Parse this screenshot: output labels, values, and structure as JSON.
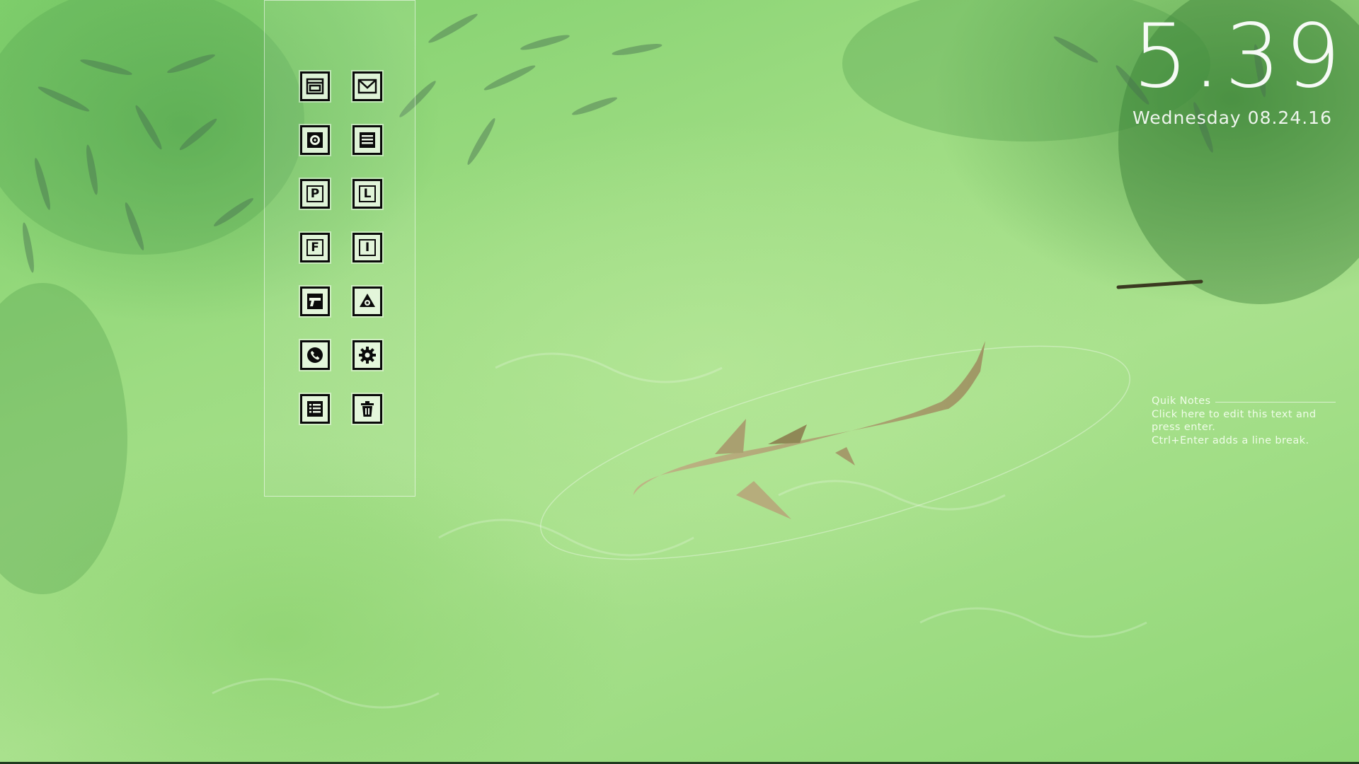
{
  "clock": {
    "time": "5.39"
  },
  "date": {
    "text": "Wednesday 08.24.16"
  },
  "launcher": {
    "icons": [
      {
        "name": "window-icon"
      },
      {
        "name": "mail-icon"
      },
      {
        "name": "speaker-icon"
      },
      {
        "name": "document-icon"
      },
      {
        "name": "p-letter-icon",
        "letter": "P"
      },
      {
        "name": "l-letter-icon",
        "letter": "L"
      },
      {
        "name": "f-letter-icon",
        "letter": "F"
      },
      {
        "name": "i-letter-icon",
        "letter": "I"
      },
      {
        "name": "gun-icon"
      },
      {
        "name": "recycle-icon"
      },
      {
        "name": "phone-icon"
      },
      {
        "name": "gear-icon"
      },
      {
        "name": "list-icon"
      },
      {
        "name": "trash-icon"
      }
    ]
  },
  "quik_notes": {
    "title": "Quik Notes",
    "lines": [
      "Click here to edit this text and",
      "press enter.",
      "Ctrl+Enter adds a line break."
    ]
  },
  "colors": {
    "water": "#9ddc82",
    "icon_ink": "#0a0a0a",
    "icon_fill": "#eef8e8",
    "text": "#ffffff"
  }
}
